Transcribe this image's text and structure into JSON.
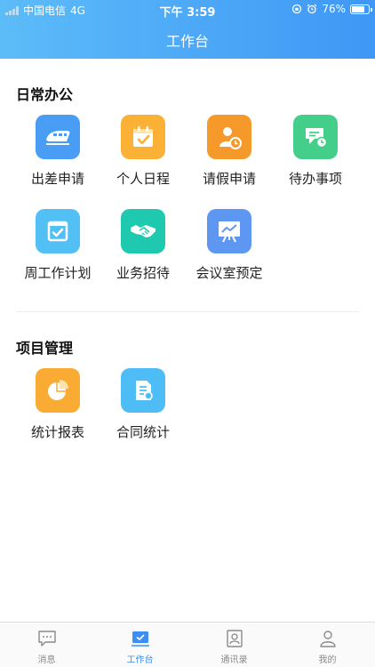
{
  "status_bar": {
    "carrier": "中国电信",
    "network": "4G",
    "time": "下午 3:59",
    "battery_percent": "76%",
    "battery_level": 0.76
  },
  "header": {
    "title": "工作台"
  },
  "sections": [
    {
      "title": "日常办公",
      "items": [
        {
          "label": "出差申请",
          "icon": "train-icon",
          "color": "#4a9df5"
        },
        {
          "label": "个人日程",
          "icon": "calendar-check-icon",
          "color": "#fbb036"
        },
        {
          "label": "请假申请",
          "icon": "person-clock-icon",
          "color": "#f59a2a"
        },
        {
          "label": "待办事项",
          "icon": "note-clock-icon",
          "color": "#43cf8a"
        },
        {
          "label": "周工作计划",
          "icon": "check-box-icon",
          "color": "#52c0f4"
        },
        {
          "label": "业务招待",
          "icon": "handshake-icon",
          "color": "#1ec9b0"
        },
        {
          "label": "会议室预定",
          "icon": "presentation-board-icon",
          "color": "#5e97f2"
        }
      ]
    },
    {
      "title": "项目管理",
      "items": [
        {
          "label": "统计报表",
          "icon": "pie-chart-icon",
          "color": "#f9ab34"
        },
        {
          "label": "合同统计",
          "icon": "document-icon",
          "color": "#4fbdf5"
        }
      ]
    }
  ],
  "tabbar": {
    "tabs": [
      {
        "label": "消息",
        "icon": "message-icon",
        "active": false
      },
      {
        "label": "工作台",
        "icon": "workbench-icon",
        "active": true
      },
      {
        "label": "通讯录",
        "icon": "contacts-icon",
        "active": false
      },
      {
        "label": "我的",
        "icon": "profile-icon",
        "active": false
      }
    ]
  },
  "colors": {
    "header_gradient_start": "#5cbcf8",
    "header_gradient_end": "#3f97f6",
    "tab_active": "#3b8ff3",
    "tab_inactive": "#8a8a8a"
  }
}
